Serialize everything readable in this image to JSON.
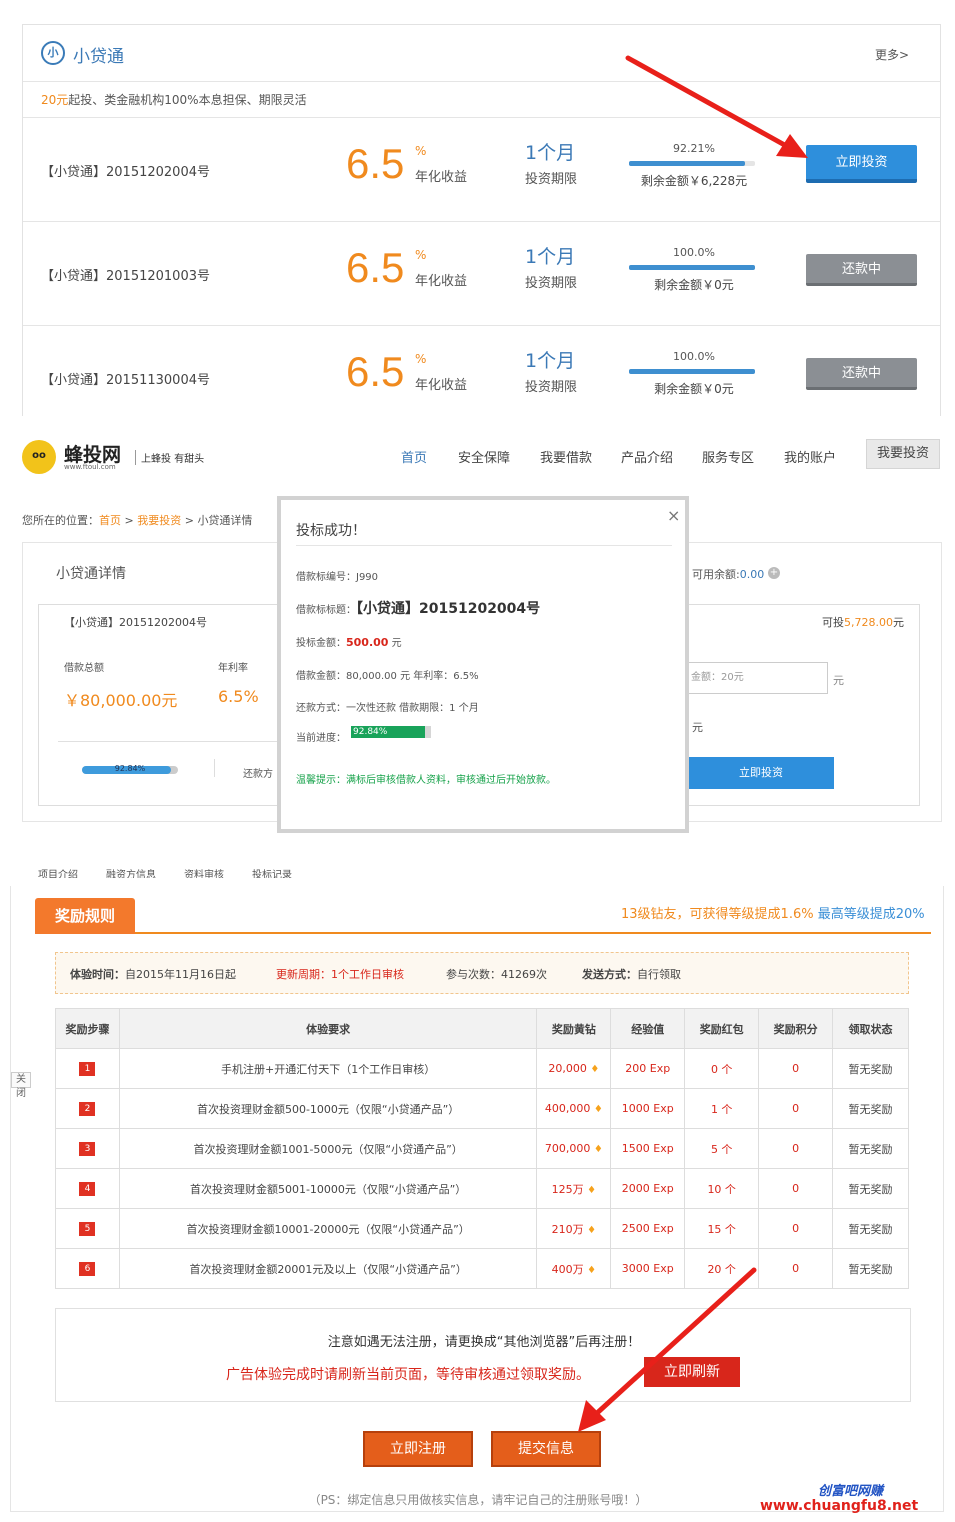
{
  "xdt": {
    "brand": "小贷通",
    "brand_icon": "小",
    "more": "更多>",
    "promo_highlight": "20元",
    "promo_text": "起投、类金融机构100%本息担保、期限灵活",
    "loans": [
      {
        "name": "【小贷通】20151202004号",
        "rate": "6.5",
        "pct": "%",
        "rate_label": "年化收益",
        "term": "1个月",
        "term_label": "投资期限",
        "progress_text": "92.21%",
        "progress": 0.9221,
        "remain": "剩余金额￥6,228元",
        "button": "立即投资",
        "status": "invest"
      },
      {
        "name": "【小贷通】20151201003号",
        "rate": "6.5",
        "pct": "%",
        "rate_label": "年化收益",
        "term": "1个月",
        "term_label": "投资期限",
        "progress_text": "100.0%",
        "progress": 1.0,
        "remain": "剩余金额￥0元",
        "button": "还款中",
        "status": "repaying"
      },
      {
        "name": "【小贷通】20151130004号",
        "rate": "6.5",
        "pct": "%",
        "rate_label": "年化收益",
        "term": "1个月",
        "term_label": "投资期限",
        "progress_text": "100.0%",
        "progress": 1.0,
        "remain": "剩余金额￥0元",
        "button": "还款中",
        "status": "repaying"
      }
    ]
  },
  "site": {
    "logo_face": "oo",
    "name": "蜂投网",
    "url": "www.ftoul.com",
    "slogan": "上蜂投 有甜头",
    "nav": [
      "首页",
      "安全保障",
      "我要借款",
      "产品介绍",
      "服务专区",
      "我的账户"
    ],
    "nav_cta": "我要投资",
    "breadcrumb_prefix": "您所在的位置：",
    "breadcrumb_home": "首页",
    "breadcrumb_sep": " > ",
    "breadcrumb_invest": "我要投资",
    "breadcrumb_current": "小贷通详情",
    "detail_title": "小贷通详情",
    "detail_name": "【小贷通】20151202004号",
    "amount_label": "借款总额",
    "amount": "￥80,000.00元",
    "rate_label": "年利率",
    "rate": "6.5%",
    "progress_text": "92.84%",
    "progress": 0.9284,
    "repay_label": "还款方",
    "avail_label": "可用余额:",
    "avail_value": "0.00",
    "avail_plus": "+",
    "can_invest_label": "可投",
    "can_invest_value": "5,728.00",
    "can_invest_unit": "元",
    "amount_placeholder": "金额：20元",
    "amount_unit": "元",
    "yuan": "元",
    "invest_button": "立即投资"
  },
  "modal": {
    "title": "投标成功！",
    "close": "×",
    "code_label": "借款标编号：",
    "code": "J990",
    "loan_title_label": "借款标标题：",
    "loan_title": "【小贷通】20151202004号",
    "bid_label": "投标金额：",
    "bid_amount": "500.00",
    "bid_unit": " 元",
    "loan_line": "借款金额：80,000.00 元   年利率：6.5%",
    "repay_line": "还款方式：一次性还款    借款期限：1 个月",
    "progress_label": "当前进度：",
    "progress_text": "92.84%",
    "progress": 0.9284,
    "tip": "温馨提示：满标后审核借款人资料，审核通过后开始放款。"
  },
  "tabs": [
    "项目介绍",
    "融资方信息",
    "资料审核",
    "投标记录"
  ],
  "rules": {
    "tab": "奖励规则",
    "level_text": "13级钻友，可获得等级提成1.6%",
    "level_max": "最高等级提成20%",
    "info": {
      "time_label": "体验时间：",
      "time": "自2015年11月16日起",
      "period": "更新周期：1个工作日审核",
      "count_label": "参与次数：",
      "count": "41269次",
      "send_label": "发送方式：",
      "send": "自行领取"
    },
    "columns": [
      "奖励步骤",
      "体验要求",
      "奖励黄钻",
      "经验值",
      "奖励红包",
      "奖励积分",
      "领取状态"
    ],
    "rows": [
      {
        "step": "1",
        "req": "手机注册+开通汇付天下（1个工作日审核）",
        "diamond": "20,000",
        "exp": "200 Exp",
        "packet": "0 个",
        "points": "0",
        "status": "暂无奖励"
      },
      {
        "step": "2",
        "req": "首次投资理财金额500-1000元（仅限“小贷通产品”）",
        "diamond": "400,000",
        "exp": "1000 Exp",
        "packet": "1 个",
        "points": "0",
        "status": "暂无奖励"
      },
      {
        "step": "3",
        "req": "首次投资理财金额1001-5000元（仅限“小贷通产品”）",
        "diamond": "700,000",
        "exp": "1500 Exp",
        "packet": "5 个",
        "points": "0",
        "status": "暂无奖励"
      },
      {
        "step": "4",
        "req": "首次投资理财金额5001-10000元（仅限“小贷通产品”）",
        "diamond": "125万",
        "exp": "2000 Exp",
        "packet": "10 个",
        "points": "0",
        "status": "暂无奖励"
      },
      {
        "step": "5",
        "req": "首次投资理财金额10001-20000元（仅限“小贷通产品”）",
        "diamond": "210万",
        "exp": "2500 Exp",
        "packet": "15 个",
        "points": "0",
        "status": "暂无奖励"
      },
      {
        "step": "6",
        "req": "首次投资理财金额20001元及以上（仅限“小贷通产品”）",
        "diamond": "400万",
        "exp": "3000 Exp",
        "packet": "20 个",
        "points": "0",
        "status": "暂无奖励"
      }
    ],
    "gem_icon": "♦",
    "close_tag": "关闭",
    "notice_1": "注意如遇无法注册，请更换成“其他浏览器”后再注册！",
    "notice_2": "广告体验完成时请刷新当前页面，等待审核通过领取奖励。",
    "refresh_button": "立即刷新",
    "register_button": "立即注册",
    "submit_button": "提交信息",
    "ps": "（PS：绑定信息只用做核实信息，请牢记自己的注册账号哦！）"
  },
  "watermark": {
    "top": "创富吧网赚",
    "bottom": "www.chuangfu8.net"
  },
  "colors": {
    "accent_orange": "#f08a1e",
    "brand_blue": "#3b79b6",
    "invest_blue": "#2e8fdc",
    "alert_red": "#d8261b",
    "arrow_red": "#e8201a"
  }
}
